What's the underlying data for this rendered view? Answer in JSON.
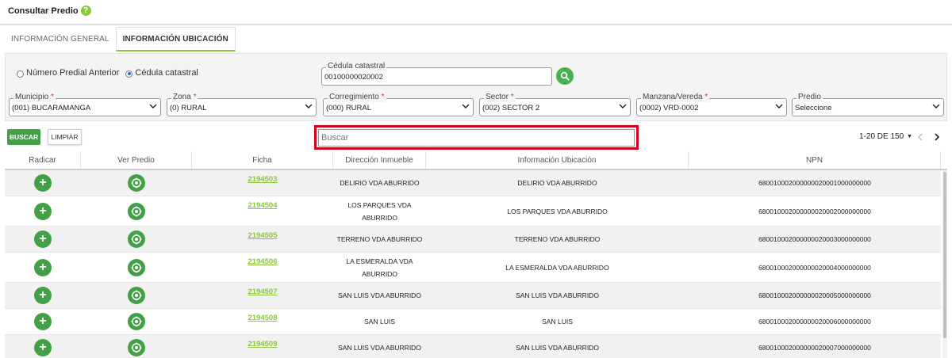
{
  "header": {
    "title": "Consultar Predio",
    "help_symbol": "?"
  },
  "tabs": [
    {
      "label": "INFORMACIÓN GENERAL",
      "active": false
    },
    {
      "label": "INFORMACIÓN UBICACIÓN",
      "active": true
    }
  ],
  "filters": {
    "radio_options": [
      {
        "label": "Número Predial Anterior",
        "checked": false
      },
      {
        "label": "Cédula catastral",
        "checked": true
      }
    ],
    "cedula": {
      "label": "Cédula catastral",
      "value": "00100000020002"
    },
    "selects": [
      {
        "label": "Municipio",
        "required": true,
        "value": "(001) BUCARAMANGA"
      },
      {
        "label": "Zona",
        "required": true,
        "value": "(0) RURAL"
      },
      {
        "label": "Corregimiento",
        "required": true,
        "value": "(000) RURAL"
      },
      {
        "label": "Sector",
        "required": true,
        "value": "(002) SECTOR 2"
      },
      {
        "label": "Manzana/Vereda",
        "required": true,
        "value": "(0002) VRD-0002"
      },
      {
        "label": "Predio",
        "required": false,
        "value": "Seleccione"
      }
    ],
    "required_mark": "*"
  },
  "toolbar": {
    "buscar_label": "BUSCAR",
    "limpiar_label": "LIMPIAR",
    "search_placeholder": "Buscar",
    "pager_text": "1-20 DE 150"
  },
  "table": {
    "columns": [
      "Radicar",
      "Ver Predio",
      "Ficha",
      "Dirección Inmueble",
      "Información Ubicación",
      "NPN"
    ],
    "rows": [
      {
        "ficha": "2194503",
        "direccion": "DELIRIO VDA ABURRIDO",
        "ubicacion": "DELIRIO VDA ABURRIDO",
        "npn": "680010002000000020001000000000"
      },
      {
        "ficha": "2194504",
        "direccion": "LOS PARQUES VDA ABURRIDO",
        "ubicacion": "LOS PARQUES VDA ABURRIDO",
        "npn": "680010002000000020002000000000"
      },
      {
        "ficha": "2194505",
        "direccion": "TERRENO VDA ABURRIDO",
        "ubicacion": "TERRENO VDA ABURRIDO",
        "npn": "680010002000000020003000000000"
      },
      {
        "ficha": "2194506",
        "direccion": "LA ESMERALDA VDA ABURRIDO",
        "ubicacion": "LA ESMERALDA VDA ABURRIDO",
        "npn": "680010002000000020004000000000"
      },
      {
        "ficha": "2194507",
        "direccion": "SAN LUIS VDA ABURRIDO",
        "ubicacion": "SAN LUIS VDA ABURRIDO",
        "npn": "680010002000000020005000000000"
      },
      {
        "ficha": "2194508",
        "direccion": "SAN LUIS",
        "ubicacion": "SAN LUIS",
        "npn": "680010002000000020006000000000"
      },
      {
        "ficha": "2194509",
        "direccion": "SAN LUIS VDA ABURRIDO",
        "ubicacion": "SAN LUIS VDA ABURRIDO",
        "npn": "680010002000000020007000000000"
      }
    ]
  },
  "colors": {
    "accent_green": "#8cc63f",
    "button_green": "#43a047",
    "highlight_red": "#d0021b"
  },
  "icons": {
    "help": "help-circle-icon",
    "search": "search-icon",
    "add": "plus-circle-icon",
    "view": "target-view-icon"
  }
}
